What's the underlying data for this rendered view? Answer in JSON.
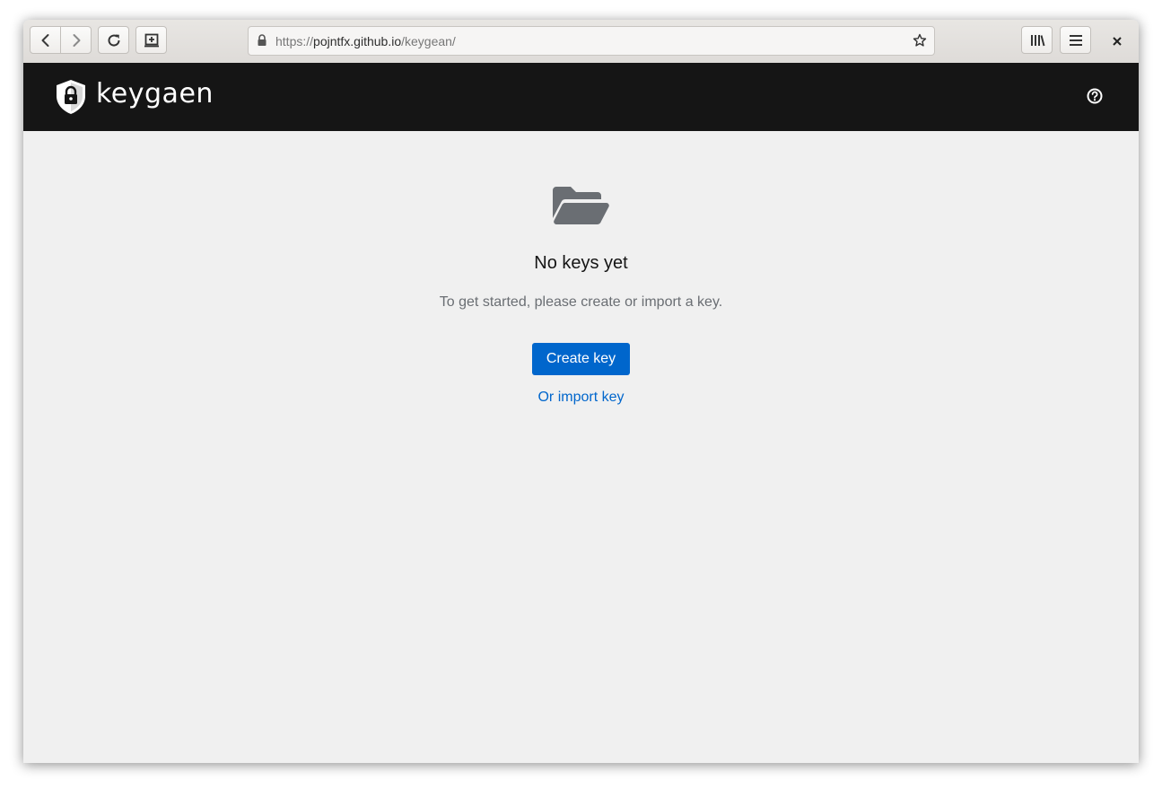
{
  "browser": {
    "url_scheme": "https://",
    "url_domain": "pojntfx.github.io",
    "url_path": "/keygean/",
    "icons": {
      "back": "chevron-left-icon",
      "forward": "chevron-right-icon",
      "reload": "reload-icon",
      "new_tab": "new-tab-icon",
      "lock": "lock-icon",
      "bookmark": "star-icon",
      "library": "library-icon",
      "menu": "hamburger-icon",
      "close": "close-icon"
    }
  },
  "header": {
    "brand": "keygaen",
    "logo_icon": "shield-lock-icon",
    "help_icon": "question-circle-icon"
  },
  "empty_state": {
    "icon": "folder-open-icon",
    "title": "No keys yet",
    "description": "To get started, please create or import a key.",
    "primary_action": "Create key",
    "secondary_action": "Or import key"
  },
  "colors": {
    "header_bg": "#151515",
    "page_bg": "#f0f0f0",
    "primary": "#0066cc",
    "muted_text": "#6a6e73",
    "folder_icon": "#6a6e73"
  }
}
